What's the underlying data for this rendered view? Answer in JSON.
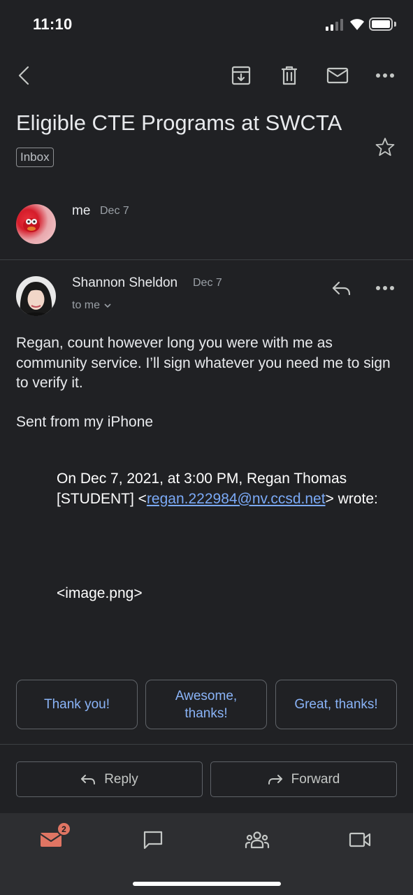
{
  "status_bar": {
    "time": "11:10"
  },
  "toolbar": {
    "back_icon": "arrow-left-icon",
    "archive_icon": "archive-icon",
    "delete_icon": "trash-icon",
    "mark_unread_icon": "mail-icon",
    "more_icon": "more-horizontal-icon"
  },
  "email": {
    "subject": "Eligible CTE Programs at SWCTA",
    "label": "Inbox",
    "thread": [
      {
        "sender": "me",
        "date": "Dec 7"
      },
      {
        "sender": "Shannon Sheldon",
        "date": "Dec 7",
        "recipient": "to me"
      }
    ],
    "body": {
      "paragraph1": "Regan, count however long you were with me as community service. I’ll sign whatever you need me to sign to verify it.",
      "signature": "Sent from my iPhone",
      "quote_intro": "On Dec 7, 2021, at 3:00 PM, Regan Thomas [STUDENT] <",
      "quote_email": "regan.222984@nv.ccsd.net",
      "quote_outro": "> wrote:",
      "attachment": "<image.png>"
    }
  },
  "smart_replies": [
    "Thank you!",
    "Awesome, thanks!",
    "Great, thanks!"
  ],
  "actions": {
    "reply": "Reply",
    "forward": "Forward"
  },
  "bottom_nav": {
    "mail_badge": "2",
    "items": [
      "mail-icon",
      "chat-icon",
      "spaces-icon",
      "meet-icon"
    ]
  },
  "colors": {
    "background": "#202124",
    "link": "#7baaf7",
    "smart_reply_text": "#8ab4f8",
    "badge": "#e07563"
  }
}
